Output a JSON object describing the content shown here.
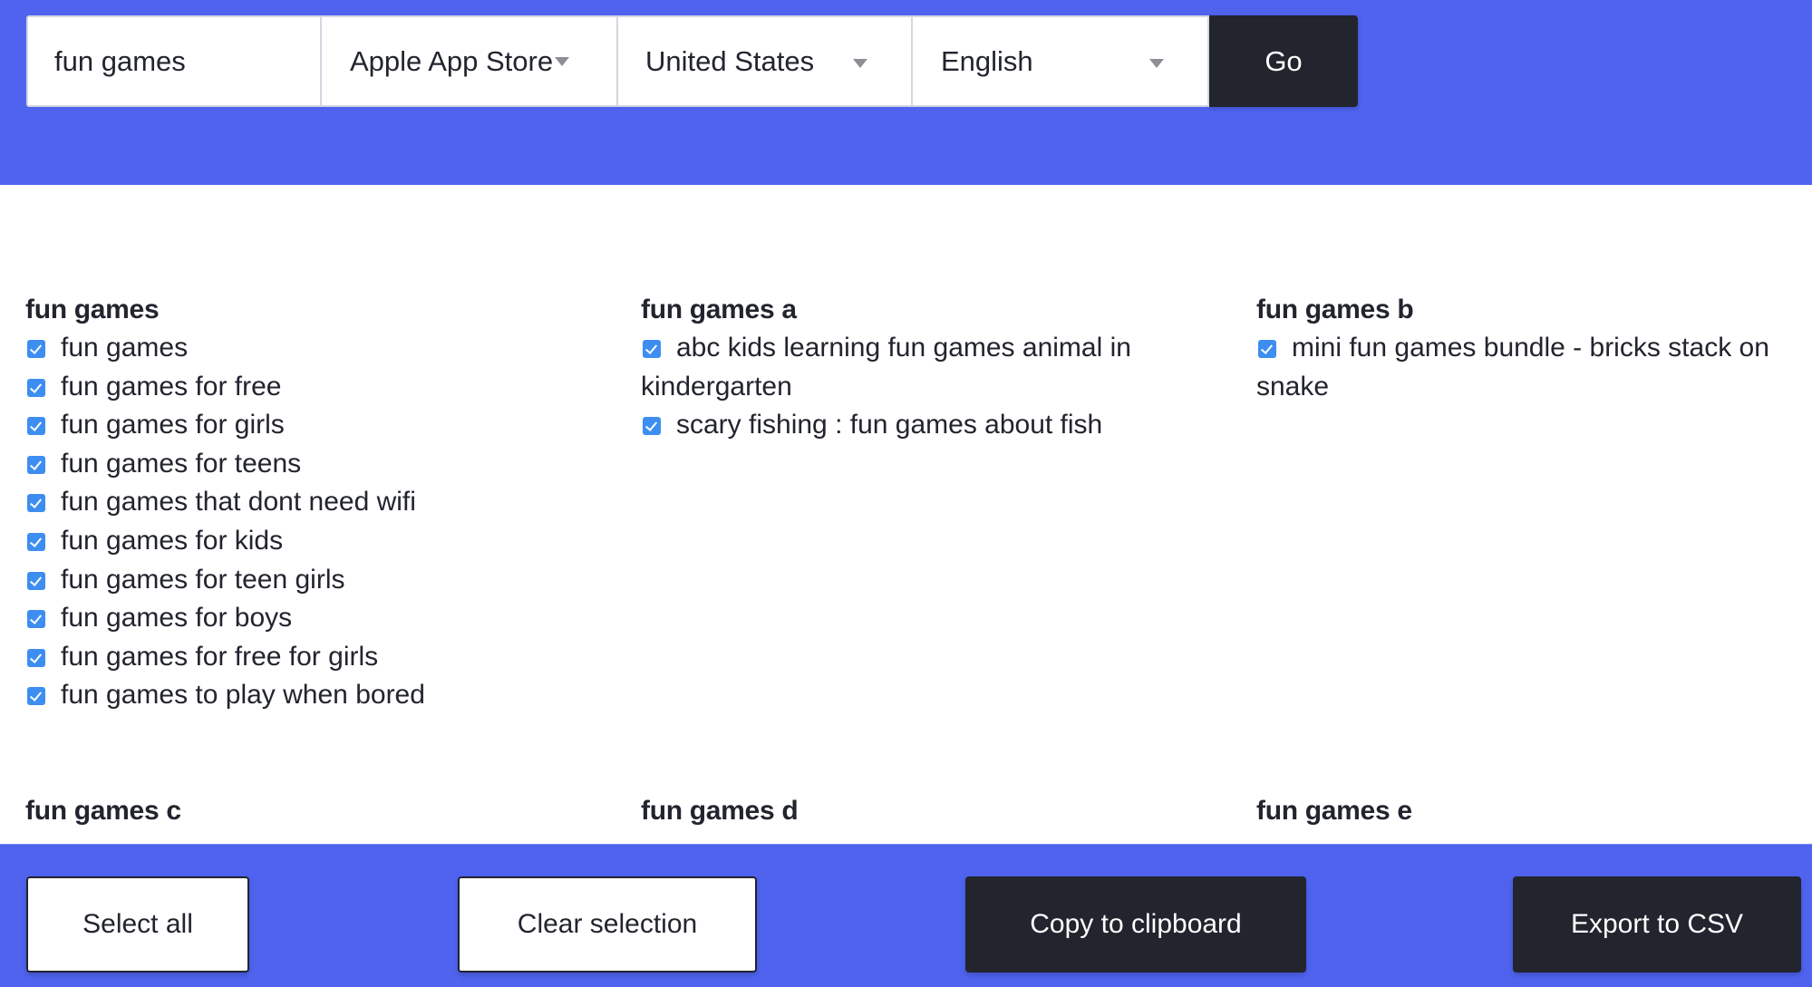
{
  "search": {
    "query": "fun games",
    "placeholder": "",
    "store": "Apple App Store",
    "country": "United States",
    "language": "English",
    "go_label": "Go"
  },
  "groups": [
    {
      "title": "fun games",
      "items": [
        {
          "label": "fun games",
          "checked": true
        },
        {
          "label": "fun games for free",
          "checked": true
        },
        {
          "label": "fun games for girls",
          "checked": true
        },
        {
          "label": "fun games for teens",
          "checked": true
        },
        {
          "label": "fun games that dont need wifi",
          "checked": true
        },
        {
          "label": "fun games for kids",
          "checked": true
        },
        {
          "label": "fun games for teen girls",
          "checked": true
        },
        {
          "label": "fun games for boys",
          "checked": true
        },
        {
          "label": "fun games for free for girls",
          "checked": true
        },
        {
          "label": "fun games to play when bored",
          "checked": true
        }
      ]
    },
    {
      "title": "fun games a",
      "items": [
        {
          "label": "abc kids learning fun games animal in kindergarten",
          "checked": true
        },
        {
          "label": "scary fishing : fun games about fish",
          "checked": true
        }
      ]
    },
    {
      "title": "fun games b",
      "items": [
        {
          "label": "mini fun games bundle - bricks stack on snake",
          "checked": true
        }
      ]
    },
    {
      "title": "fun games c",
      "items": []
    },
    {
      "title": "fun games d",
      "items": []
    },
    {
      "title": "fun games e",
      "items": []
    }
  ],
  "footer": {
    "select_all": "Select all",
    "clear_selection": "Clear selection",
    "copy_clipboard": "Copy to clipboard",
    "export_csv": "Export to CSV"
  },
  "colors": {
    "brand_blue": "#4f63ef",
    "dark": "#22242e",
    "checkbox": "#3d8ef0"
  }
}
